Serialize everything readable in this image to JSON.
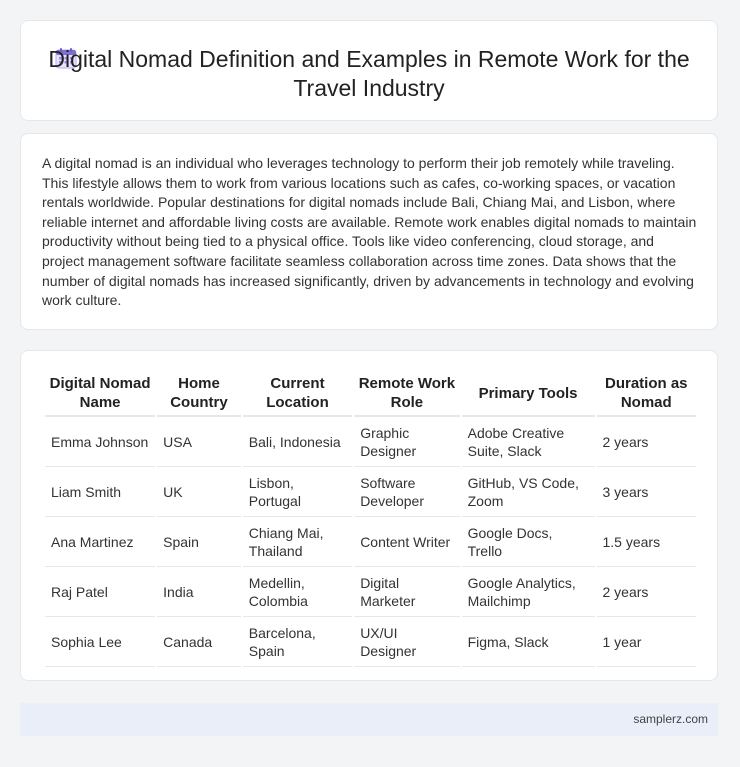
{
  "header": {
    "title": "Digital Nomad Definition and Examples in Remote Work for the Travel Industry",
    "icon": "calendar-icon"
  },
  "intro": {
    "text": "A digital nomad is an individual who leverages technology to perform their job remotely while traveling. This lifestyle allows them to work from various locations such as cafes, co-working spaces, or vacation rentals worldwide. Popular destinations for digital nomads include Bali, Chiang Mai, and Lisbon, where reliable internet and affordable living costs are available. Remote work enables digital nomads to maintain productivity without being tied to a physical office. Tools like video conferencing, cloud storage, and project management software facilitate seamless collaboration across time zones. Data shows that the number of digital nomads has increased significantly, driven by advancements in technology and evolving work culture."
  },
  "table": {
    "headers": [
      "Digital Nomad Name",
      "Home Country",
      "Current Location",
      "Remote Work Role",
      "Primary Tools",
      "Duration as Nomad"
    ],
    "rows": [
      [
        "Emma Johnson",
        "USA",
        "Bali, Indonesia",
        "Graphic Designer",
        "Adobe Creative Suite, Slack",
        "2 years"
      ],
      [
        "Liam Smith",
        "UK",
        "Lisbon, Portugal",
        "Software Developer",
        "GitHub, VS Code, Zoom",
        "3 years"
      ],
      [
        "Ana Martinez",
        "Spain",
        "Chiang Mai, Thailand",
        "Content Writer",
        "Google Docs, Trello",
        "1.5 years"
      ],
      [
        "Raj Patel",
        "India",
        "Medellin, Colombia",
        "Digital Marketer",
        "Google Analytics, Mailchimp",
        "2 years"
      ],
      [
        "Sophia Lee",
        "Canada",
        "Barcelona, Spain",
        "UX/UI Designer",
        "Figma, Slack",
        "1 year"
      ]
    ]
  },
  "footer": {
    "source": "samplerz.com"
  },
  "colors": {
    "icon_top": "#7c6fd6",
    "icon_body": "#e8e2fb",
    "footer_bg": "#e9eef8"
  }
}
